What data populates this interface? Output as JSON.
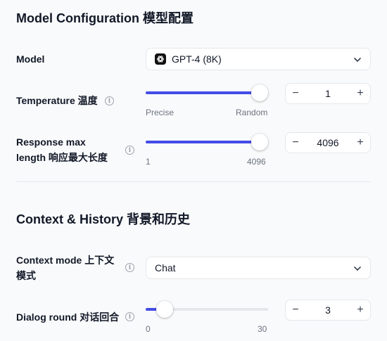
{
  "model_section": {
    "title": "Model Configuration 模型配置"
  },
  "model": {
    "label": "Model",
    "value": "GPT-4 (8K)",
    "logo_icon": "openai-logo-icon"
  },
  "temperature": {
    "label": "Temperature 温度",
    "value": "1",
    "slider_fraction": 1.0,
    "min_caption": "Precise",
    "max_caption": "Random"
  },
  "max_length": {
    "label_line1": "Response max",
    "label_line2": "length 响应最大长度",
    "value": "4096",
    "slider_fraction": 1.0,
    "min_caption": "1",
    "max_caption": "4096"
  },
  "context_section": {
    "title": "Context & History 背景和历史"
  },
  "context_mode": {
    "label_line1": "Context mode 上下文",
    "label_line2": "模式",
    "value": "Chat"
  },
  "dialog_round": {
    "label": "Dialog round 对话回合",
    "value": "3",
    "slider_fraction": 0.1,
    "min_caption": "0",
    "max_caption": "30"
  },
  "stepper": {
    "minus": "−",
    "plus": "+"
  },
  "colors": {
    "accent": "#444ce7",
    "track": "#e5e7eb",
    "background": "#f9fafb"
  }
}
